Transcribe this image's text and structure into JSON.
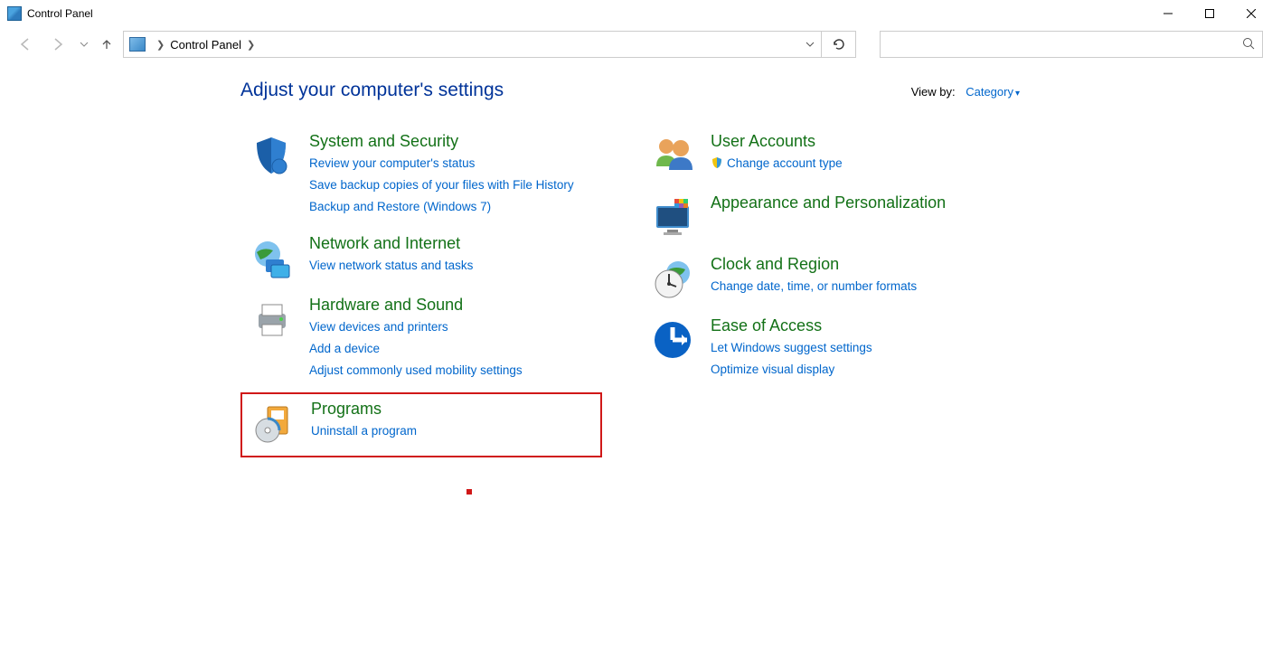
{
  "window": {
    "title": "Control Panel"
  },
  "breadcrumb": {
    "text": "Control Panel"
  },
  "page": {
    "heading": "Adjust your computer's settings",
    "viewby_label": "View by:",
    "viewby_value": "Category"
  },
  "left": [
    {
      "key": "system-security",
      "title": "System and Security",
      "links": [
        "Review your computer's status",
        "Save backup copies of your files with File History",
        "Backup and Restore (Windows 7)"
      ]
    },
    {
      "key": "network-internet",
      "title": "Network and Internet",
      "links": [
        "View network status and tasks"
      ]
    },
    {
      "key": "hardware-sound",
      "title": "Hardware and Sound",
      "links": [
        "View devices and printers",
        "Add a device",
        "Adjust commonly used mobility settings"
      ]
    },
    {
      "key": "programs",
      "title": "Programs",
      "links": [
        "Uninstall a program"
      ],
      "highlighted": true
    }
  ],
  "right": [
    {
      "key": "user-accounts",
      "title": "User Accounts",
      "links": [
        "Change account type"
      ],
      "shield_on_links": [
        0
      ]
    },
    {
      "key": "appearance",
      "title": "Appearance and Personalization",
      "links": []
    },
    {
      "key": "clock-region",
      "title": "Clock and Region",
      "links": [
        "Change date, time, or number formats"
      ]
    },
    {
      "key": "ease-of-access",
      "title": "Ease of Access",
      "links": [
        "Let Windows suggest settings",
        "Optimize visual display"
      ]
    }
  ],
  "icons": {
    "system-security": "shield-icon",
    "network-internet": "globe-network-icon",
    "hardware-sound": "printer-icon",
    "programs": "disc-box-icon",
    "user-accounts": "people-icon",
    "appearance": "monitor-colors-icon",
    "clock-region": "clock-globe-icon",
    "ease-of-access": "ease-access-icon"
  }
}
